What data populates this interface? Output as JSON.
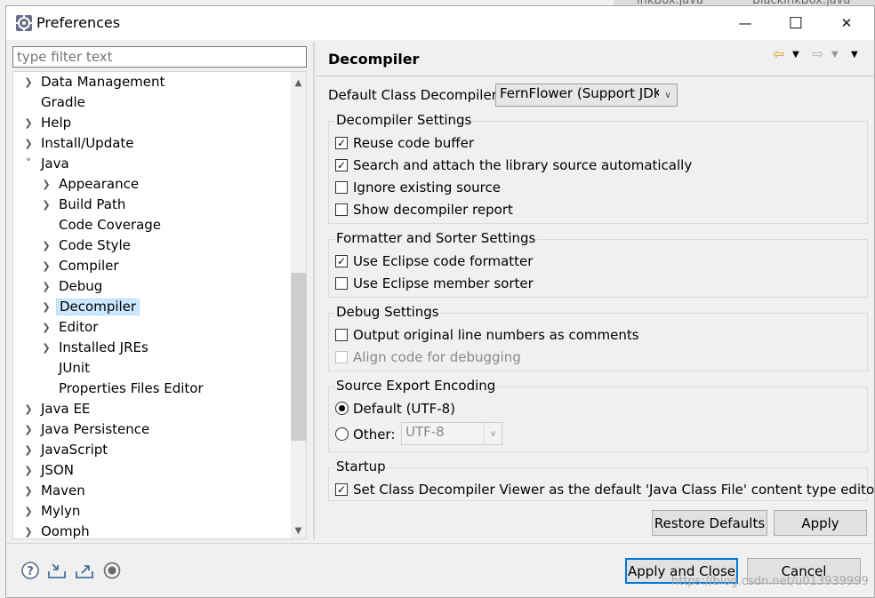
{
  "background_tabs": [
    "inkBox.java",
    "BlackInkBox.java"
  ],
  "window": {
    "title": "Preferences",
    "minimize_glyph": "—",
    "maximize_glyph": "☐",
    "close_glyph": "✕"
  },
  "filter": {
    "placeholder": "type filter text"
  },
  "tree": {
    "items": [
      {
        "label": "Data Management",
        "level": 0,
        "state": "collapsed"
      },
      {
        "label": "Gradle",
        "level": 0,
        "state": "leaf"
      },
      {
        "label": "Help",
        "level": 0,
        "state": "collapsed"
      },
      {
        "label": "Install/Update",
        "level": 0,
        "state": "collapsed"
      },
      {
        "label": "Java",
        "level": 0,
        "state": "expanded"
      },
      {
        "label": "Appearance",
        "level": 1,
        "state": "collapsed"
      },
      {
        "label": "Build Path",
        "level": 1,
        "state": "collapsed"
      },
      {
        "label": "Code Coverage",
        "level": 1,
        "state": "leaf"
      },
      {
        "label": "Code Style",
        "level": 1,
        "state": "collapsed"
      },
      {
        "label": "Compiler",
        "level": 1,
        "state": "collapsed"
      },
      {
        "label": "Debug",
        "level": 1,
        "state": "collapsed"
      },
      {
        "label": "Decompiler",
        "level": 1,
        "state": "collapsed",
        "selected": true
      },
      {
        "label": "Editor",
        "level": 1,
        "state": "collapsed"
      },
      {
        "label": "Installed JREs",
        "level": 1,
        "state": "collapsed"
      },
      {
        "label": "JUnit",
        "level": 1,
        "state": "leaf"
      },
      {
        "label": "Properties Files Editor",
        "level": 1,
        "state": "leaf"
      },
      {
        "label": "Java EE",
        "level": 0,
        "state": "collapsed"
      },
      {
        "label": "Java Persistence",
        "level": 0,
        "state": "collapsed"
      },
      {
        "label": "JavaScript",
        "level": 0,
        "state": "collapsed"
      },
      {
        "label": "JSON",
        "level": 0,
        "state": "collapsed"
      },
      {
        "label": "Maven",
        "level": 0,
        "state": "collapsed"
      },
      {
        "label": "Mylyn",
        "level": 0,
        "state": "collapsed"
      },
      {
        "label": "Oomph",
        "level": 0,
        "state": "collapsed"
      }
    ]
  },
  "page": {
    "title": "Decompiler",
    "default_decompiler": {
      "label": "Default Class Decompiler",
      "value": "FernFlower (Support JDK"
    },
    "groups": {
      "decompiler_settings": {
        "title": "Decompiler Settings",
        "options": [
          {
            "label": "Reuse code buffer",
            "checked": true
          },
          {
            "label": "Search and attach the library source automatically",
            "checked": true
          },
          {
            "label": "Ignore existing source",
            "checked": false
          },
          {
            "label": "Show decompiler report",
            "checked": false
          }
        ]
      },
      "formatter": {
        "title": "Formatter and Sorter Settings",
        "options": [
          {
            "label": "Use Eclipse code formatter",
            "checked": true
          },
          {
            "label": "Use Eclipse member sorter",
            "checked": false
          }
        ]
      },
      "debug": {
        "title": "Debug Settings",
        "options": [
          {
            "label": "Output original line numbers as comments",
            "checked": false
          },
          {
            "label": "Align code for debugging",
            "checked": false,
            "disabled": true
          }
        ]
      },
      "encoding": {
        "title": "Source Export Encoding",
        "default_label": "Default (UTF-8)",
        "other_label": "Other:",
        "other_value": "UTF-8",
        "selected": "default"
      },
      "startup": {
        "title": "Startup",
        "options": [
          {
            "label": "Set Class Decompiler Viewer as the default 'Java Class File' content type editor",
            "checked": true
          }
        ]
      }
    },
    "restore_defaults": "Restore Defaults",
    "apply": "Apply"
  },
  "footer": {
    "apply_and_close": "Apply and Close",
    "cancel": "Cancel",
    "watermark": "https://blog.csdn.net/u013939999"
  },
  "glyphs": {
    "check": "✓",
    "collapsed": "›",
    "expanded": "⌄"
  },
  "colors": {
    "selection": "#cce8ff",
    "default_button_border": "#0078d7",
    "toolbar_arrow": "#e09a1a"
  }
}
